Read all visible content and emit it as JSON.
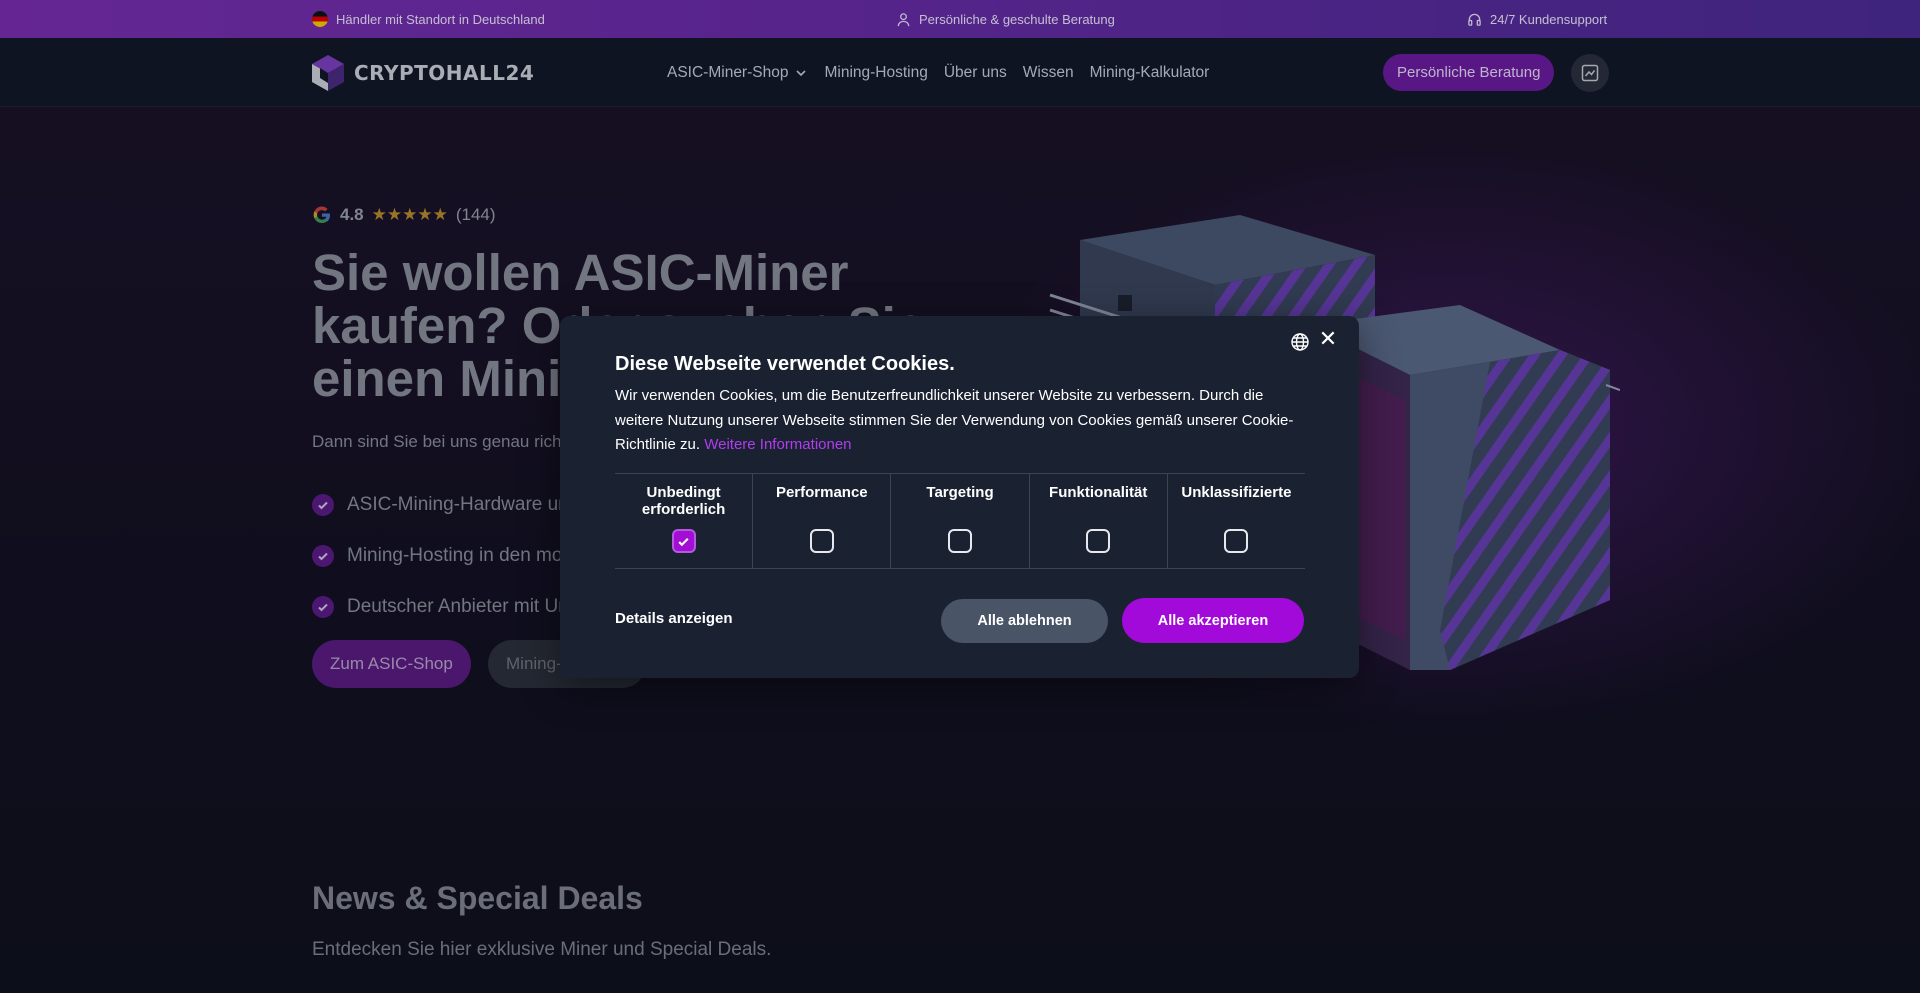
{
  "topbar": {
    "left": "Händler mit Standort in Deutschland",
    "center": "Persönliche & geschulte Beratung",
    "right": "24/7 Kundensupport",
    "left_icon": "flag-de-icon",
    "center_icon": "user-icon",
    "right_icon": "headset-icon"
  },
  "nav": {
    "logo_text": "CRYPTOHALL24",
    "items": [
      "ASIC-Miner-Shop",
      "Mining-Hosting",
      "Über uns",
      "Wissen",
      "Mining-Kalkulator"
    ],
    "consult_button": "Persönliche Beratung",
    "chart_button_icon": "chart-icon"
  },
  "hero": {
    "rating_score": "4.8",
    "rating_stars": "★★★★★",
    "rating_count": "(144)",
    "headline": "Sie wollen ASIC-Miner kaufen? Oder suchen Sie einen Mining-Hosting?",
    "subline": "Dann sind Sie bei uns genau richtig.",
    "bullets": [
      "ASIC-Mining-Hardware und Zubehör",
      "Mining-Hosting in den modernsten Rechenzentren",
      "Deutscher Anbieter mit Unternehmenssitz in Deutschland"
    ],
    "cta_shop": "Zum ASIC-Shop",
    "cta_hosting": "Mining-Hosting"
  },
  "news": {
    "title": "News & Special Deals",
    "subtitle": "Entdecken Sie hier exklusive Miner und Special Deals."
  },
  "cookie": {
    "title": "Diese Webseite verwendet Cookies.",
    "text": "Wir verwenden Cookies, um die Benutzerfreundlichkeit unserer Website zu verbessern. Durch die weitere Nutzung unserer Webseite stimmen Sie der Verwendung von Cookies gemäß unserer Cookie-Richtlinie zu.",
    "link": "Weitere Informationen",
    "categories": [
      {
        "label": "Unbedingt erforderlich",
        "checked": true
      },
      {
        "label": "Performance",
        "checked": false
      },
      {
        "label": "Targeting",
        "checked": false
      },
      {
        "label": "Funktionalität",
        "checked": false
      },
      {
        "label": "Unklassifizierte",
        "checked": false
      }
    ],
    "details": "Details anzeigen",
    "reject": "Alle ablehnen",
    "accept": "Alle akzeptieren",
    "close_symbol": "✕"
  },
  "colors": {
    "brand": "#a10ad8",
    "topbar": "#6a2aa8",
    "modal_bg": "#1a2232"
  }
}
